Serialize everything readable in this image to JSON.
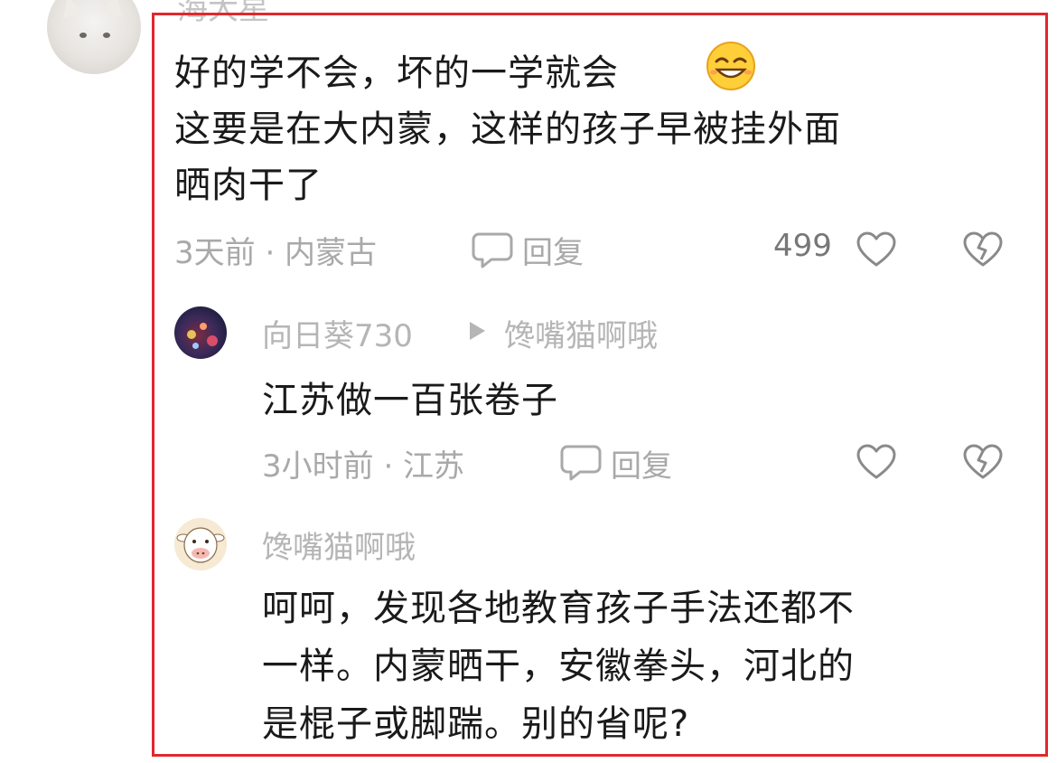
{
  "main_comment": {
    "username": "海大星",
    "lines": [
      "好的学不会，坏的一学就会",
      "这要是在大内蒙，这样的孩子早被挂外面",
      "晒肉干了"
    ],
    "emoji_icon": "grin-emoji-icon",
    "time_location": "3天前 · 内蒙古",
    "reply_label": "回复",
    "like_count": "499"
  },
  "replies": [
    {
      "username": "向日葵730",
      "reply_to": "馋嘴猫啊哦",
      "lines": [
        "江苏做一百张卷子"
      ],
      "time_location": "3小时前 · 江苏",
      "reply_label": "回复"
    },
    {
      "username": "馋嘴猫啊哦",
      "lines": [
        "呵呵，发现各地教育孩子手法还都不",
        "一样。内蒙晒干，安徽拳头，河北的",
        "是棍子或脚踹。别的省呢?"
      ]
    }
  ],
  "colors": {
    "highlight_border": "#e0282d",
    "meta_text": "#a9a9a9",
    "body_text": "#1a1a1a"
  }
}
